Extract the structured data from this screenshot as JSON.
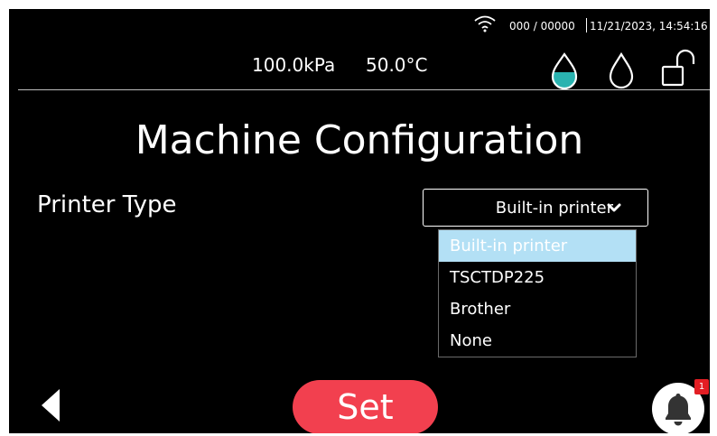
{
  "status_bar": {
    "counter": "000 / 00000",
    "datetime": "11/21/2023, 14:54:16",
    "icons": [
      "wifi-icon"
    ]
  },
  "header": {
    "pressure": "100.0kPa",
    "temperature": "50.0°C",
    "icons": [
      "drop-filled-icon",
      "drop-empty-icon",
      "unlock-icon"
    ],
    "drop_fill_color": "#2ab3b0"
  },
  "page": {
    "title": "Machine Configuration"
  },
  "printer_type": {
    "label": "Printer Type",
    "selected": "Built-in printer",
    "options": [
      "Built-in printer",
      "TSCTDP225",
      "Brother",
      "None"
    ],
    "highlight_color": "#b3e0f5"
  },
  "footer": {
    "set_label": "Set",
    "set_color": "#f2404f",
    "notification_count": "1",
    "badge_color": "#e31e24",
    "icons": [
      "back-icon",
      "bell-icon"
    ]
  }
}
